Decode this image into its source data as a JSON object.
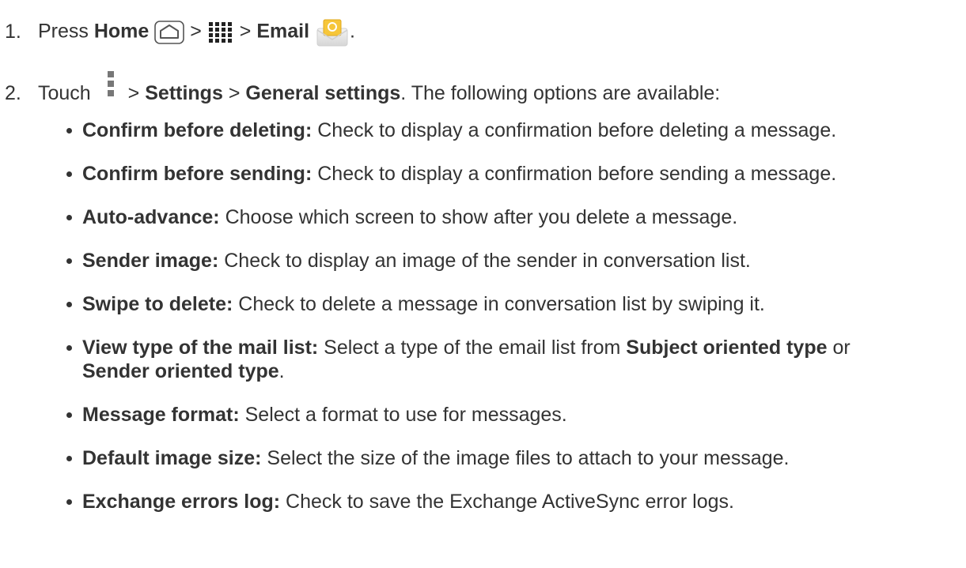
{
  "step1": {
    "number": "1.",
    "text_press": "Press",
    "home_label": "Home",
    "sep1": ">",
    "sep2": ">",
    "email_label": "Email",
    "end": "."
  },
  "step2": {
    "number": "2.",
    "text_touch": "Touch",
    "sep1": ">",
    "settings_label": "Settings",
    "sep2": ">",
    "general_label": "General settings",
    "tail": ". The following options are available:"
  },
  "options": [
    {
      "term": "Confirm before deleting:",
      "desc": "Check to display a confirmation before deleting a message."
    },
    {
      "term": "Confirm before sending:",
      "desc": "Check to display a confirmation before sending a message."
    },
    {
      "term": "Auto-advance:",
      "desc": "Choose which screen to show after you delete a message."
    },
    {
      "term": "Sender image:",
      "desc": "Check to display an image of the sender in conversation list."
    },
    {
      "term": "Swipe to delete:",
      "desc": "Check to delete a message in conversation list by swiping it."
    },
    {
      "term": "View type of the mail list:",
      "desc": "Select a type of the email list from",
      "opt1": "Subject oriented type",
      "mid": "or",
      "opt2": "Sender oriented type",
      "end": "."
    },
    {
      "term": "Message format:",
      "desc": "Select a format to use for messages."
    },
    {
      "term": "Default image size:",
      "desc": "Select the size of the image files to attach to your message."
    },
    {
      "term": "Exchange errors log:",
      "desc": "Check to save the Exchange ActiveSync error logs."
    }
  ],
  "icons": {
    "home": "home-icon",
    "apps": "apps-grid-icon",
    "email": "email-envelope-icon",
    "menu": "menu-overflow-icon"
  }
}
